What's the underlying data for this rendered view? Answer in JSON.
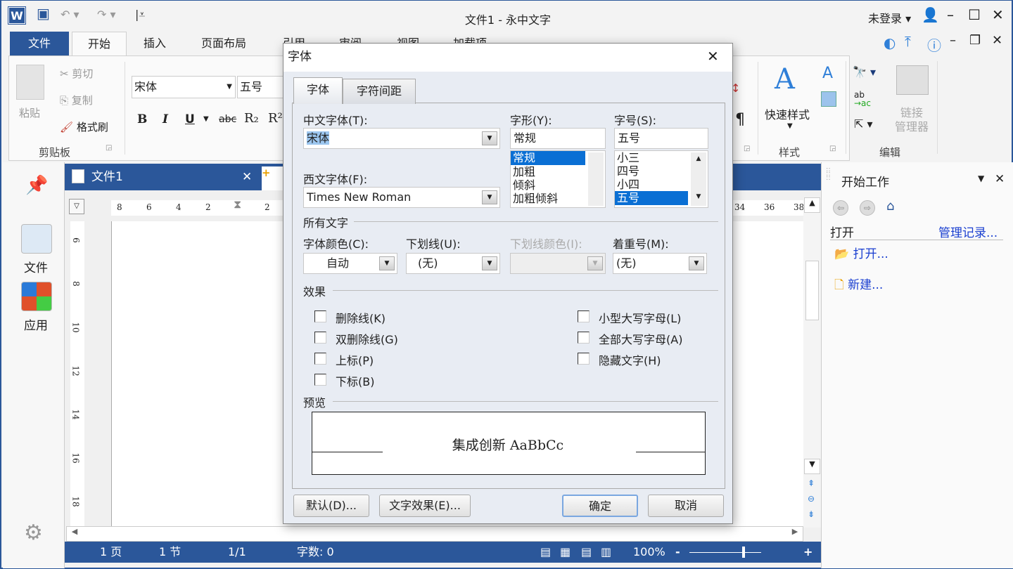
{
  "app": {
    "title": "文件1 - 永中文字",
    "user": "未登录"
  },
  "ribbon_tabs": [
    "文件",
    "开始",
    "插入",
    "页面布局",
    "引用",
    "审阅",
    "视图",
    "加载项"
  ],
  "ribbon": {
    "clipboard": {
      "paste": "粘贴",
      "cut": "剪切",
      "copy": "复制",
      "format_painter": "格式刷",
      "group": "剪贴板"
    },
    "font": {
      "name": "宋体",
      "size": "五号",
      "bold": "B",
      "italic": "I",
      "underline": "U",
      "strike": "abc",
      "sub": "R₂",
      "sup": "R²"
    },
    "styles": {
      "quick_styles": "快速样式",
      "group": "样式"
    },
    "editing": {
      "link_manager": "链接\n管理器",
      "link_1": "链接",
      "link_2": "管理器",
      "group": "编辑"
    }
  },
  "sidebar": {
    "file": "文件",
    "apps": "应用"
  },
  "doc_tab": {
    "name": "文件1"
  },
  "ruler": {
    "h": [
      "8",
      "6",
      "4",
      "2",
      "2"
    ],
    "h_right": [
      "34",
      "36",
      "38"
    ],
    "v": [
      "6",
      "8",
      "10",
      "12",
      "14",
      "16",
      "18"
    ]
  },
  "status": {
    "page": "1 页",
    "section": "1 节",
    "pages": "1/1",
    "words": "字数: 0",
    "zoom": "100%",
    "zoom_percent": 100
  },
  "task_pane": {
    "title": "开始工作",
    "open_section": "打开",
    "manage": "管理记录...",
    "open": "打开...",
    "new": "新建..."
  },
  "dialog": {
    "title": "字体",
    "tabs": [
      "字体",
      "字符间距"
    ],
    "cn_font_label": "中文字体(T):",
    "cn_font": "宋体",
    "west_font_label": "西文字体(F):",
    "west_font": "Times New Roman",
    "style_label": "字形(Y):",
    "style_value": "常规",
    "style_options": [
      "常规",
      "加粗",
      "倾斜",
      "加粗倾斜"
    ],
    "size_label": "字号(S):",
    "size_value": "五号",
    "size_options": [
      "小三",
      "四号",
      "小四",
      "五号"
    ],
    "all_text": "所有文字",
    "color_label": "字体颜色(C):",
    "color_value": "自动",
    "underline_label": "下划线(U):",
    "underline_value": "(无)",
    "underline_color_label": "下划线颜色(I):",
    "emphasis_label": "着重号(M):",
    "emphasis_value": "(无)",
    "effects": "效果",
    "effects_left": [
      "删除线(K)",
      "双删除线(G)",
      "上标(P)",
      "下标(B)"
    ],
    "effects_right": [
      "小型大写字母(L)",
      "全部大写字母(A)",
      "隐藏文字(H)"
    ],
    "preview": "预览",
    "preview_text": "集成创新 AaBbCc",
    "default_btn": "默认(D)...",
    "text_effects_btn": "文字效果(E)...",
    "ok": "确定",
    "cancel": "取消"
  },
  "colors": {
    "accent": "#2b579a",
    "selection": "#0a6fd4",
    "link": "#1a3fd0"
  }
}
